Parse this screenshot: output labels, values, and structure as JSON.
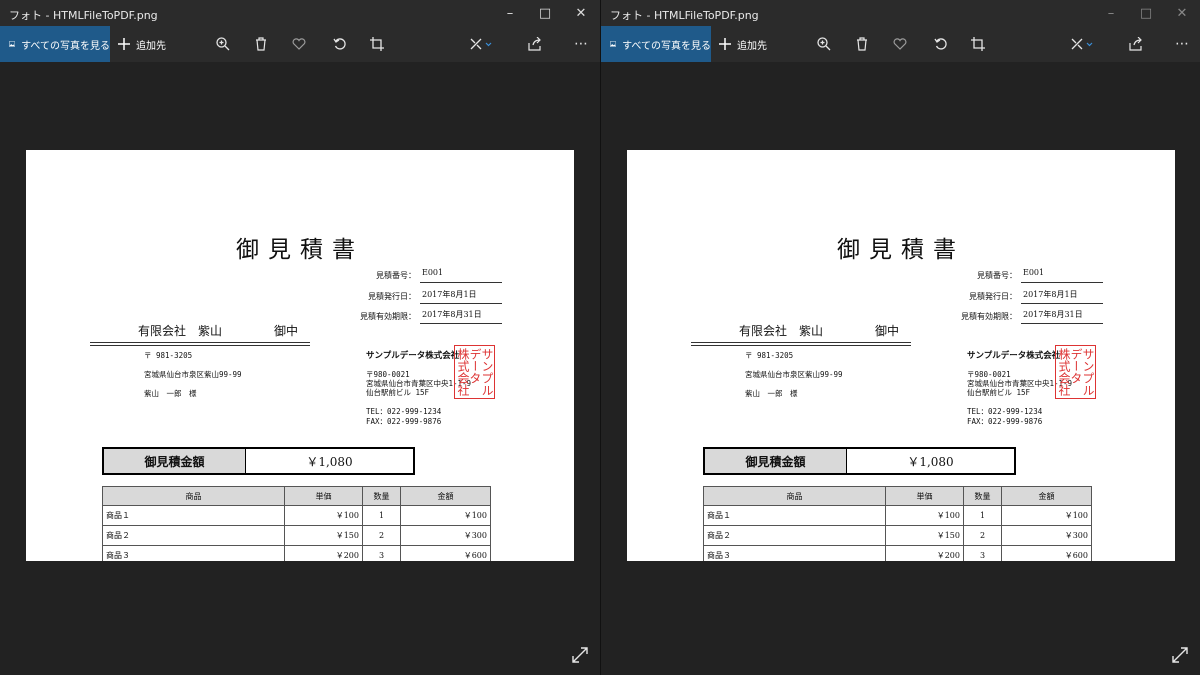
{
  "app": {
    "title": "フォト - HTMLFileToPDF.png",
    "all_photos_label": "すべての写真を見る",
    "add_to_label": "追加先"
  },
  "icons": [
    "picture-icon",
    "plus-icon",
    "zoom-icon",
    "delete-icon",
    "heart-icon",
    "rotate-icon",
    "crop-icon",
    "edit-icon",
    "share-icon",
    "more-icon",
    "minimize-icon",
    "maximize-icon",
    "close-icon",
    "expand-icon"
  ],
  "document": {
    "title": "御見積書",
    "meta": [
      {
        "label": "見積番号：",
        "value": "E001"
      },
      {
        "label": "見積発行日：",
        "value": "2017年8月1日"
      },
      {
        "label": "見積有効期限：",
        "value": "2017年8月31日"
      }
    ],
    "client_name": "有限会社　紫山",
    "client_suffix": "御中",
    "client_postal": "〒 981-3205",
    "client_address": "宮城県仙台市泉区紫山99-99",
    "client_person": "紫山　一郎　様",
    "company_name": "サンプルデータ株式会社",
    "company_postal": "〒980-0021",
    "company_address1": "宮城県仙台市青葉区中央1-1-9",
    "company_address2": "仙台駅前ビル 15F",
    "company_tel": "TEL：022-999-1234",
    "company_fax": "FAX：022-999-9876",
    "seal_cols": [
      "サンプル",
      "データ",
      "株式会社"
    ],
    "total_label": "御見積金額",
    "total_value": "￥1,080",
    "table_headers": [
      "商品",
      "単価",
      "数量",
      "金額"
    ],
    "rows": [
      {
        "item": "商品１",
        "price": "￥100",
        "qty": "1",
        "amount": "￥100"
      },
      {
        "item": "商品２",
        "price": "￥150",
        "qty": "2",
        "amount": "￥300"
      },
      {
        "item": "商品３",
        "price": "￥200",
        "qty": "3",
        "amount": "￥600"
      }
    ]
  }
}
